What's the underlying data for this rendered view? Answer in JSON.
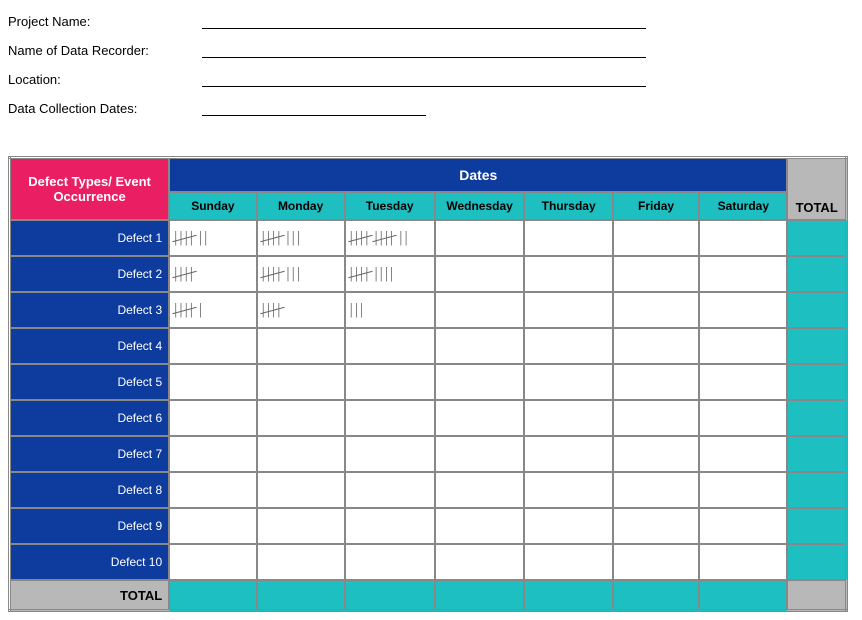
{
  "form": {
    "project_label": "Project Name:",
    "project_value": "",
    "recorder_label": "Name of Data Recorder:",
    "recorder_value": "",
    "location_label": "Location:",
    "location_value": "",
    "dates_label": "Data Collection Dates:",
    "dates_value": ""
  },
  "headers": {
    "defect_types": "Defect Types/ Event Occurrence",
    "dates": "Dates",
    "total": "TOTAL",
    "days": [
      "Sunday",
      "Monday",
      "Tuesday",
      "Wednesday",
      "Thursday",
      "Friday",
      "Saturday"
    ]
  },
  "rows": [
    {
      "label": "Defect 1",
      "tallies": [
        7,
        8,
        12,
        null,
        null,
        null,
        null
      ]
    },
    {
      "label": "Defect 2",
      "tallies": [
        5,
        8,
        9,
        null,
        null,
        null,
        null
      ]
    },
    {
      "label": "Defect 3",
      "tallies": [
        6,
        5,
        3,
        null,
        null,
        null,
        null
      ]
    },
    {
      "label": "Defect 4",
      "tallies": [
        null,
        null,
        null,
        null,
        null,
        null,
        null
      ]
    },
    {
      "label": "Defect 5",
      "tallies": [
        null,
        null,
        null,
        null,
        null,
        null,
        null
      ]
    },
    {
      "label": "Defect 6",
      "tallies": [
        null,
        null,
        null,
        null,
        null,
        null,
        null
      ]
    },
    {
      "label": "Defect 7",
      "tallies": [
        null,
        null,
        null,
        null,
        null,
        null,
        null
      ]
    },
    {
      "label": "Defect 8",
      "tallies": [
        null,
        null,
        null,
        null,
        null,
        null,
        null
      ]
    },
    {
      "label": "Defect 9",
      "tallies": [
        null,
        null,
        null,
        null,
        null,
        null,
        null
      ]
    },
    {
      "label": "Defect 10",
      "tallies": [
        null,
        null,
        null,
        null,
        null,
        null,
        null
      ]
    }
  ],
  "total_row_label": "TOTAL"
}
